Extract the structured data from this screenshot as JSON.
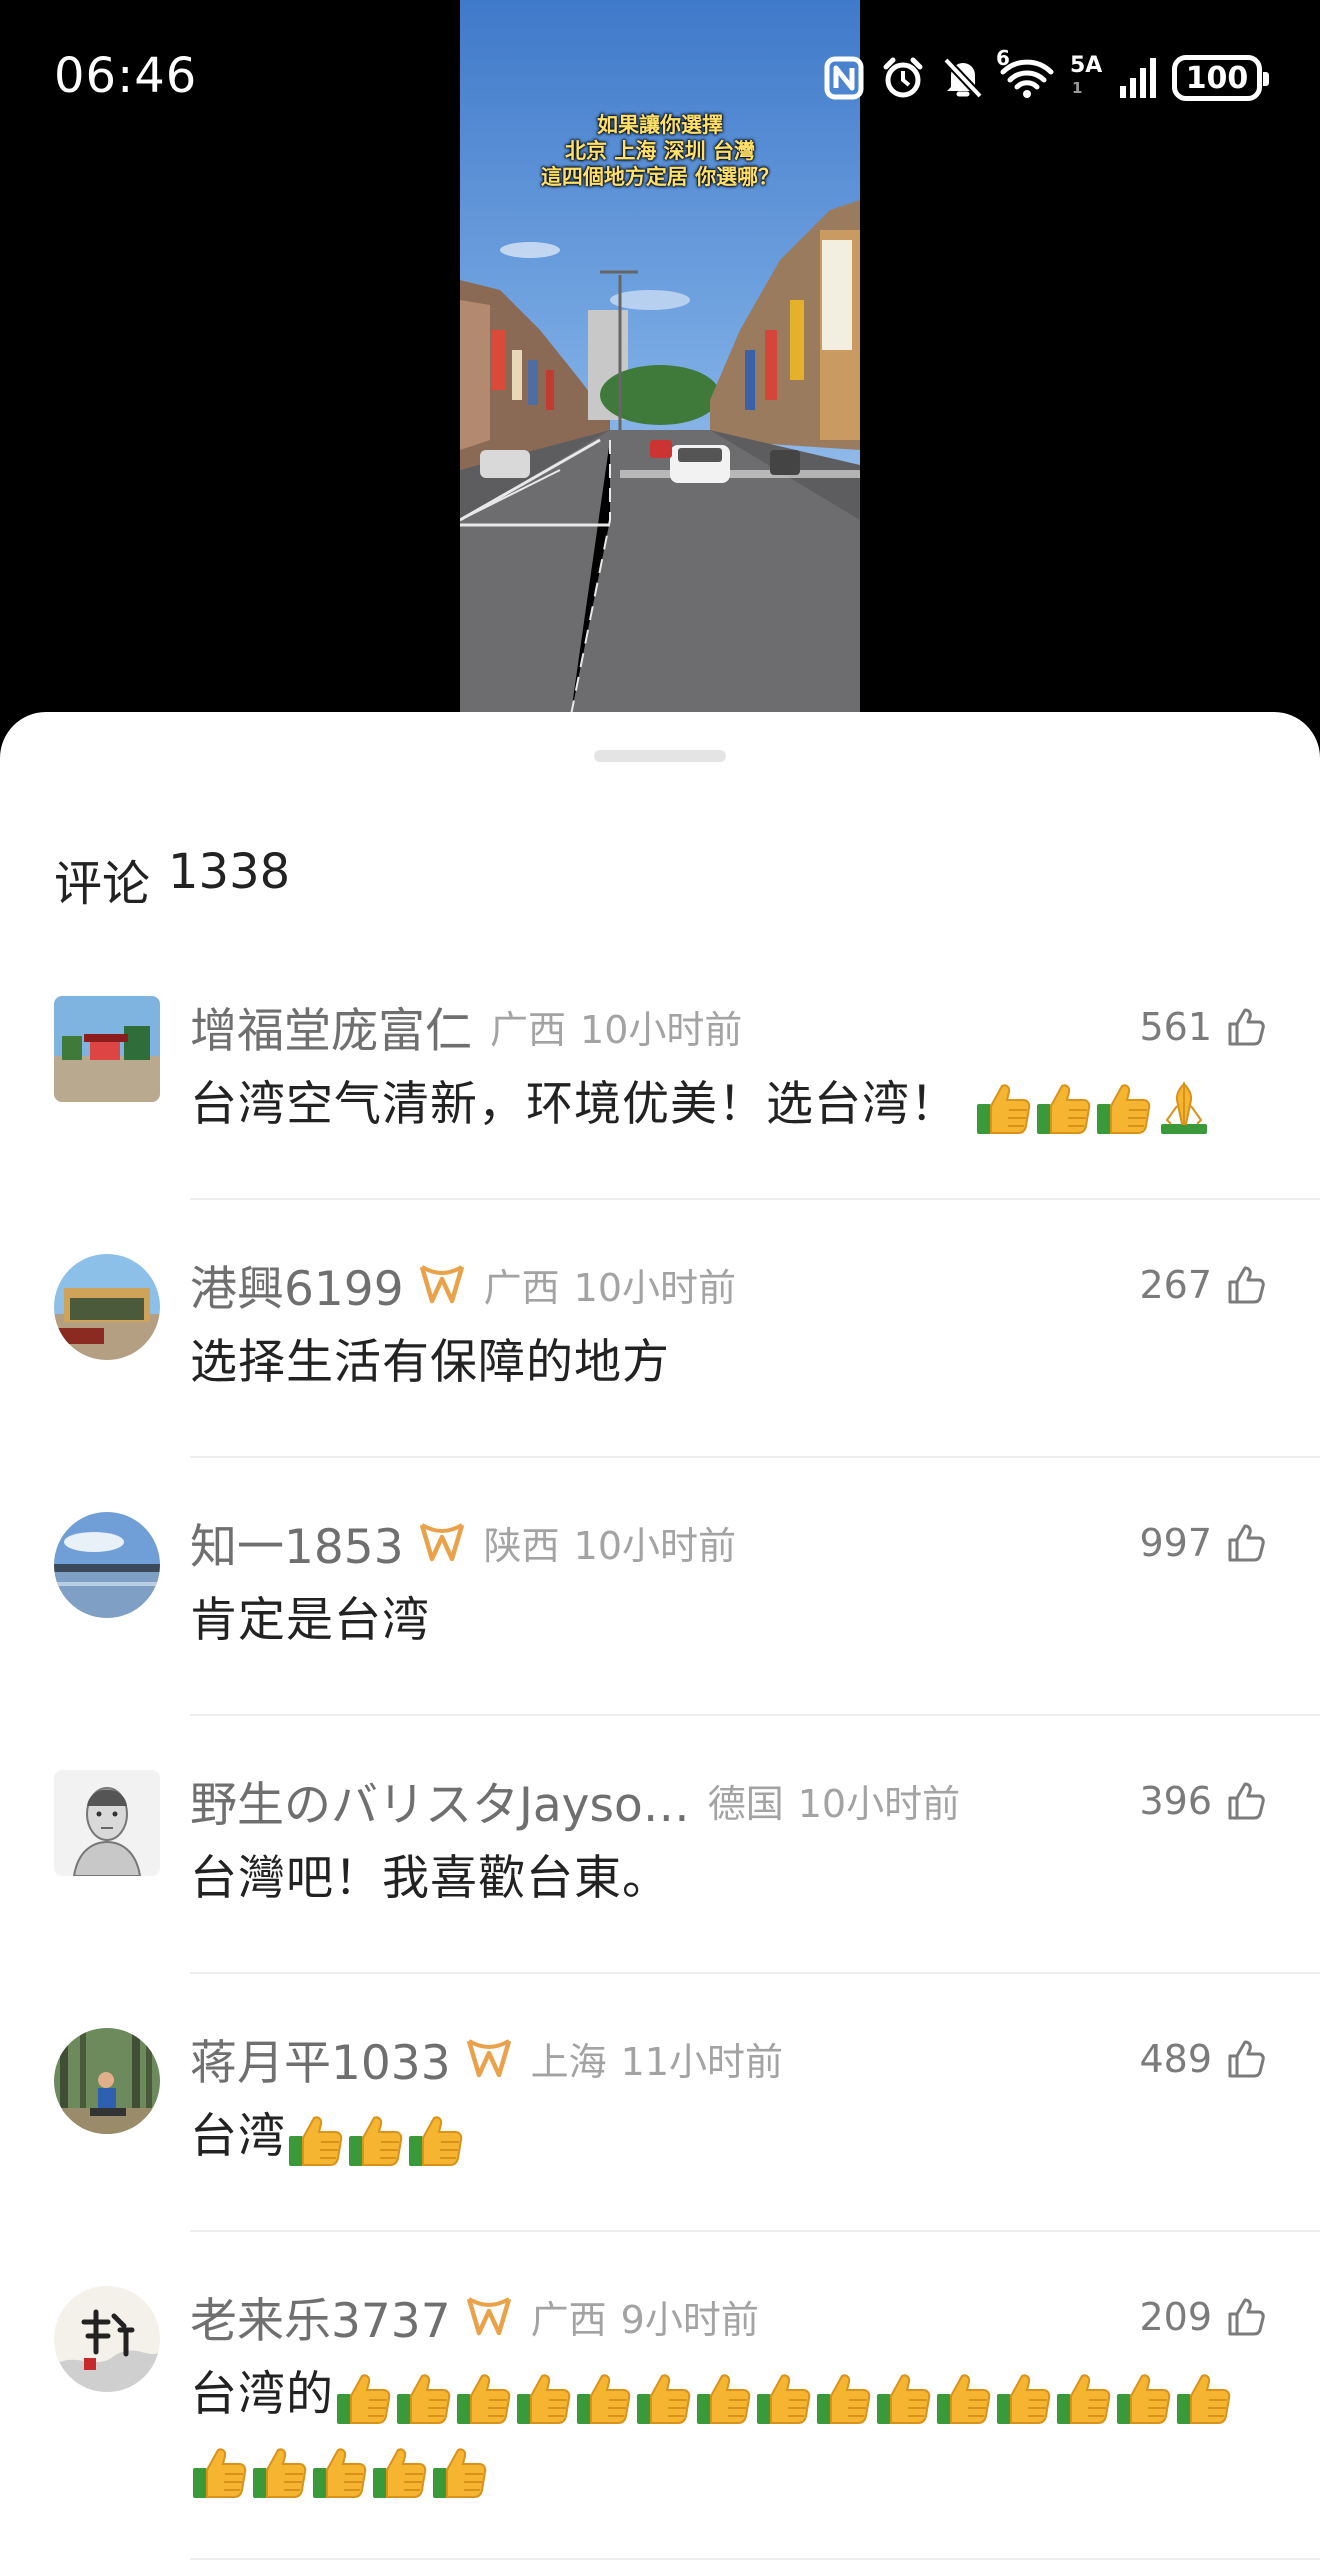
{
  "status_bar": {
    "time": "06:46",
    "network_gen": "5A",
    "network_sub": "1",
    "wifi_label": "6",
    "battery": "100",
    "icons": [
      "nfc-icon",
      "alarm-icon",
      "mute-bell-icon",
      "wifi-icon",
      "signal-icon",
      "battery-icon"
    ]
  },
  "video": {
    "caption_lines": [
      "如果讓你選擇",
      "北京 上海 深圳 台灣",
      "這四個地方定居 你選哪？"
    ]
  },
  "comments_header": {
    "label": "评论",
    "count": "1338"
  },
  "comments": [
    {
      "username": "增福堂庞富仁",
      "has_badge": false,
      "location": "广西",
      "time": "10小时前",
      "likes": "561",
      "text": "台湾空气清新，环境优美！选台湾！",
      "emojis": [
        "thumbs-up",
        "thumbs-up",
        "thumbs-up",
        "folded-hands"
      ],
      "avatar": "outdoor-square-photo"
    },
    {
      "username": "港興6199",
      "has_badge": true,
      "location": "广西",
      "time": "10小时前",
      "likes": "267",
      "text": "选择生活有保障的地方",
      "emojis": [],
      "avatar": "building-photo"
    },
    {
      "username": "知一1853",
      "has_badge": true,
      "location": "陕西",
      "time": "10小时前",
      "likes": "997",
      "text": "肯定是台湾",
      "emojis": [],
      "avatar": "lake-landscape-photo"
    },
    {
      "username": "野生のバリスタJayso…",
      "has_badge": false,
      "location": "德国",
      "time": "10小时前",
      "likes": "396",
      "text": "台灣吧！我喜歡台東。",
      "emojis": [],
      "avatar": "portrait-sketch"
    },
    {
      "username": "蒋月平1033",
      "has_badge": true,
      "location": "上海",
      "time": "11小时前",
      "likes": "489",
      "text": "台湾",
      "emojis": [
        "thumbs-up",
        "thumbs-up",
        "thumbs-up"
      ],
      "avatar": "forest-person-photo"
    },
    {
      "username": "老来乐3737",
      "has_badge": true,
      "location": "广西",
      "time": "9小时前",
      "likes": "209",
      "text": "台湾的",
      "emojis": [
        "thumbs-up",
        "thumbs-up",
        "thumbs-up",
        "thumbs-up",
        "thumbs-up",
        "thumbs-up",
        "thumbs-up",
        "thumbs-up",
        "thumbs-up",
        "thumbs-up",
        "thumbs-up",
        "thumbs-up",
        "thumbs-up",
        "thumbs-up",
        "thumbs-up",
        "thumbs-up",
        "thumbs-up",
        "thumbs-up",
        "thumbs-up",
        "thumbs-up"
      ],
      "avatar": "calligraphy-xu"
    }
  ],
  "colors": {
    "badge": "#e9a24a",
    "meta_text": "#a3a3a3",
    "username": "#6f6f6f",
    "body_text": "#222222"
  }
}
